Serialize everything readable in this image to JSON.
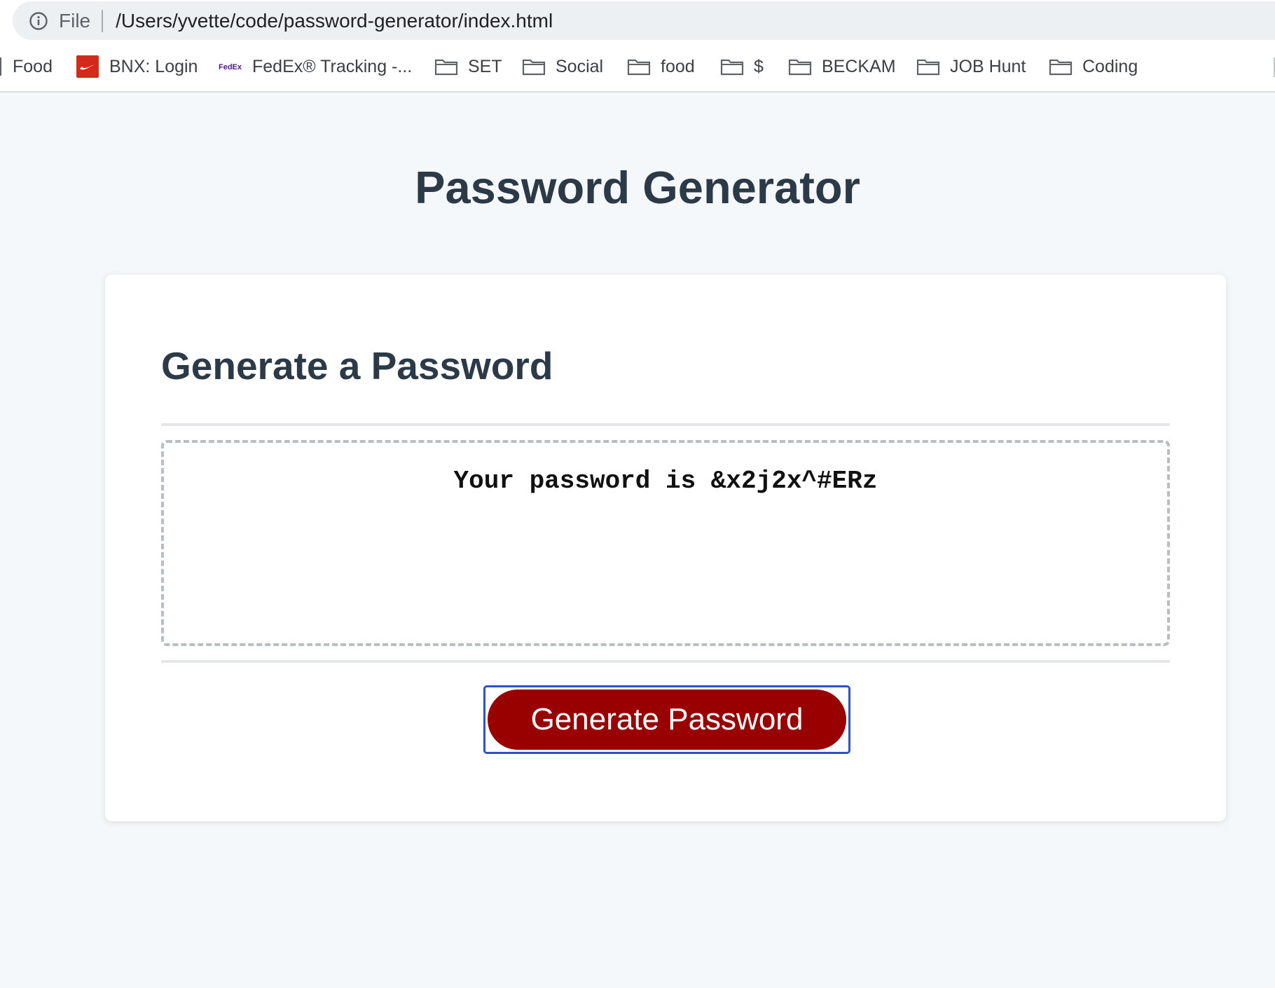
{
  "browser": {
    "omnibox": {
      "scheme_label": "File",
      "url": "/Users/yvette/code/password-generator/index.html"
    },
    "bookmarks": [
      {
        "label": "Food",
        "icon": "none"
      },
      {
        "label": "BNX: Login",
        "icon": "nike-favicon"
      },
      {
        "label": "FedEx® Tracking -...",
        "icon": "fedex-favicon"
      },
      {
        "label": "SET",
        "icon": "folder-icon"
      },
      {
        "label": "Social",
        "icon": "folder-icon"
      },
      {
        "label": "food",
        "icon": "folder-icon"
      },
      {
        "label": "$",
        "icon": "folder-icon"
      },
      {
        "label": "BECKAM",
        "icon": "folder-icon"
      },
      {
        "label": "JOB Hunt",
        "icon": "folder-icon"
      },
      {
        "label": "Coding",
        "icon": "folder-icon"
      }
    ],
    "favicon_text": {
      "fedex": "FedEx"
    }
  },
  "page": {
    "title": "Password Generator",
    "card": {
      "heading": "Generate a Password",
      "password_output": "Your password is &x2j2x^#ERz",
      "button_label": "Generate Password"
    }
  },
  "colors": {
    "button_bg": "#990000",
    "button_text": "#ffffff",
    "focus_ring": "#2f4fd0",
    "heading": "#2c3a47",
    "page_bg": "#f5f8fb"
  }
}
